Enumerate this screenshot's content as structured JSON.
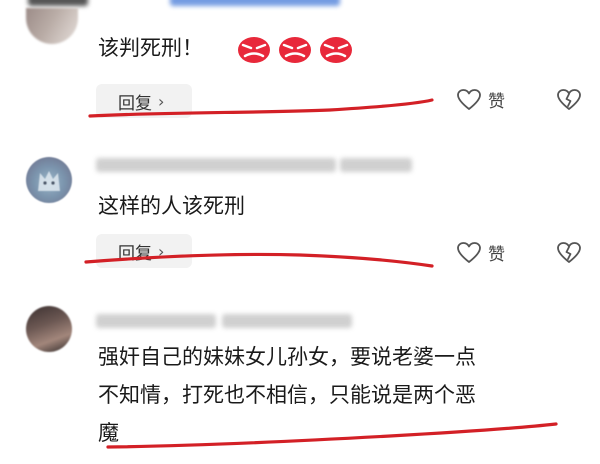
{
  "comments": [
    {
      "text": "该判死刑！",
      "reply_label": "回复",
      "like_label": "赞"
    },
    {
      "text": "这样的人该死刑",
      "reply_label": "回复",
      "like_label": "赞"
    },
    {
      "lines": [
        "强奸自己的妹妹女儿孙女，要说老婆一点",
        "不知情，打死也不相信，只能说是两个恶",
        "魔"
      ]
    }
  ],
  "icons": {
    "emoji": "angry-face-emoji",
    "like": "heart-outline-icon",
    "dislike": "broken-heart-icon",
    "reply_chevron": "chevron-right-icon"
  },
  "colors": {
    "underline": "#d32026",
    "emoji_red": "#e8283a",
    "reply_bg": "#f2f2f2"
  }
}
